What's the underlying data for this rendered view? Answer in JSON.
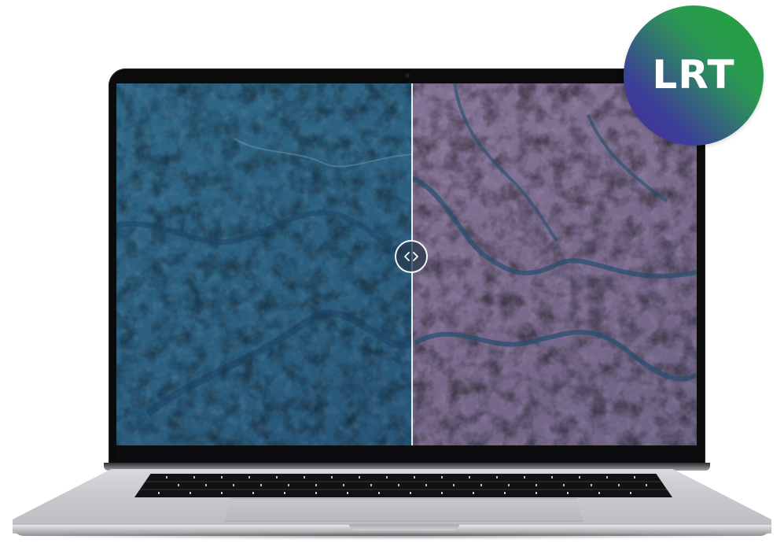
{
  "logo": {
    "text": "LRT",
    "colors": {
      "top_right": "#21a038",
      "bottom_left": "#4a2a8f"
    }
  },
  "comparison": {
    "handle_icon": "chevron-left-right-icon",
    "divider_position_fraction": 0.51,
    "left_image": {
      "description_color": "#2b5a7a"
    },
    "right_image": {
      "description_color": "#7a6a8a"
    }
  },
  "device": {
    "type": "laptop"
  }
}
